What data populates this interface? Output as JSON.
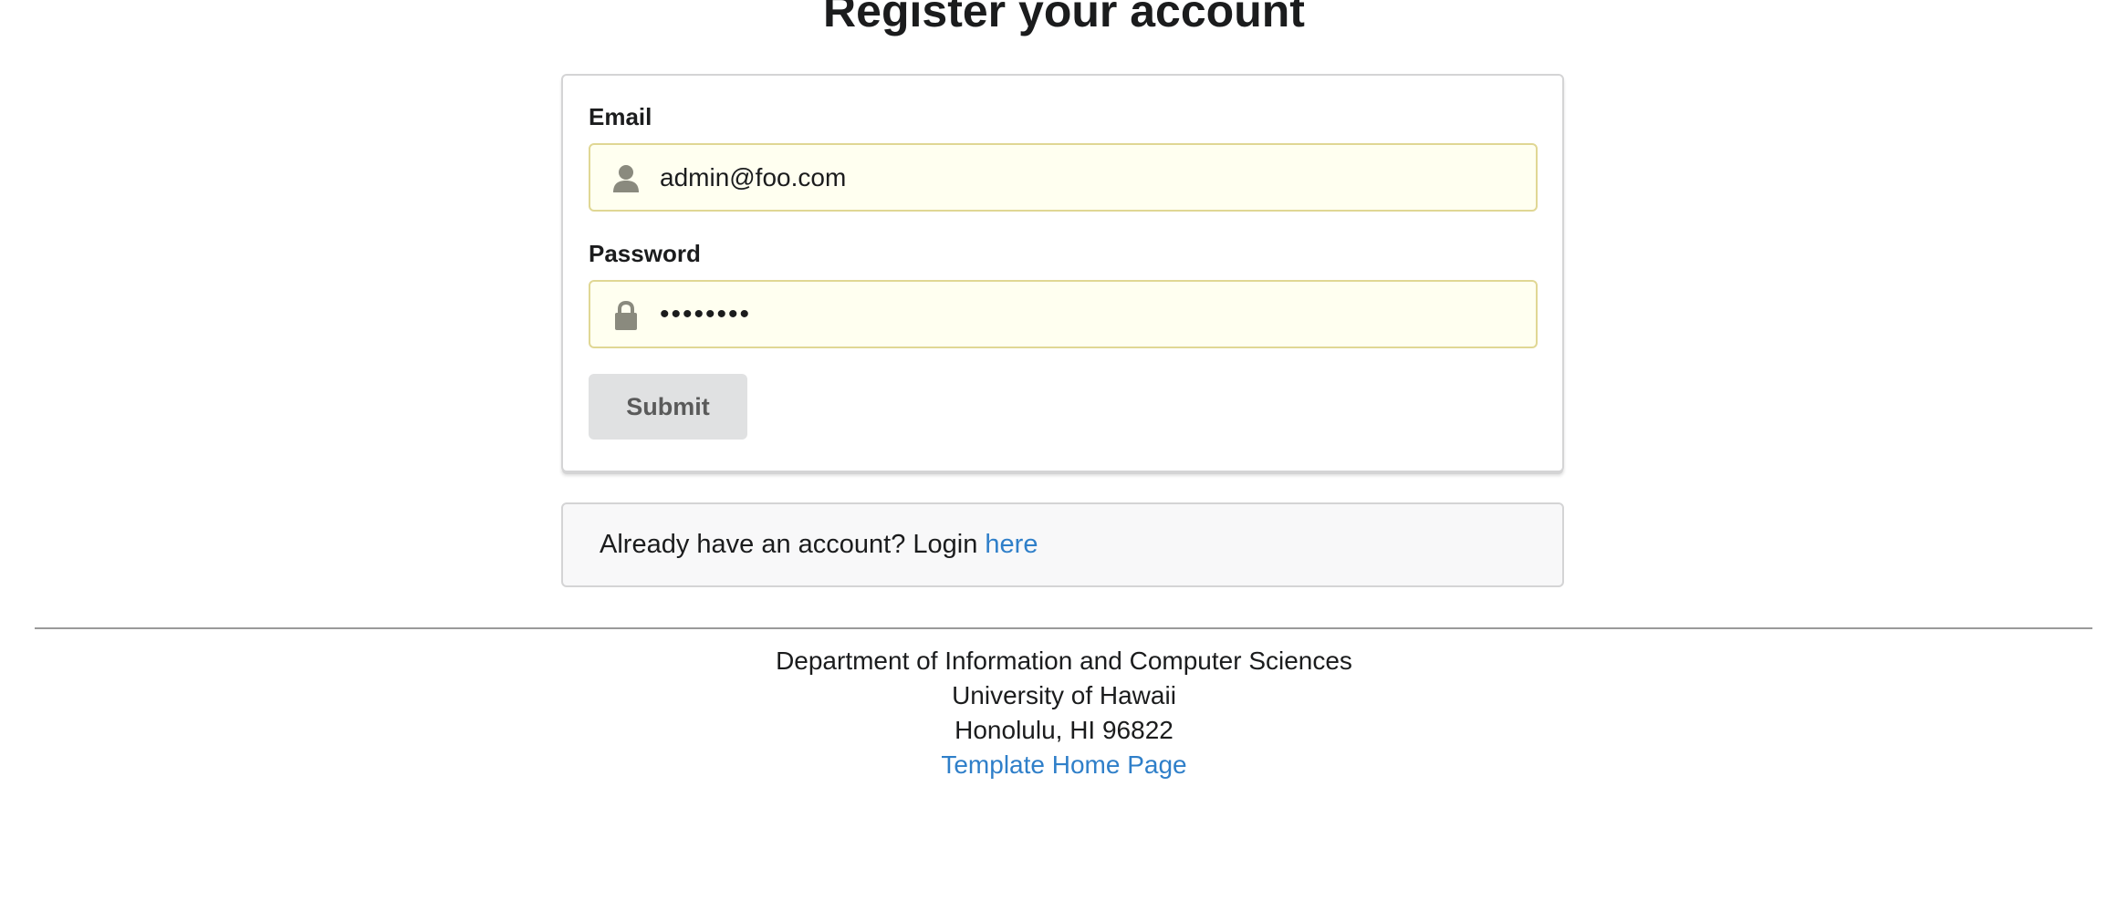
{
  "page": {
    "title": "Register your account"
  },
  "form": {
    "email_label": "Email",
    "email_value": "admin@foo.com",
    "email_icon": "user-icon",
    "password_label": "Password",
    "password_value": "••••••••",
    "password_icon": "lock-icon",
    "submit_label": "Submit"
  },
  "login_prompt": {
    "text": "Already have an account? Login ",
    "link_text": "here"
  },
  "footer": {
    "department": "Department of Information and Computer Sciences",
    "university": "University of Hawaii",
    "address": "Honolulu, HI 96822",
    "link_text": "Template Home Page"
  },
  "colors": {
    "link": "#2f7fc9",
    "input_background": "#fffff0",
    "input_border": "#e0d794",
    "button_background": "#e0e1e2"
  }
}
